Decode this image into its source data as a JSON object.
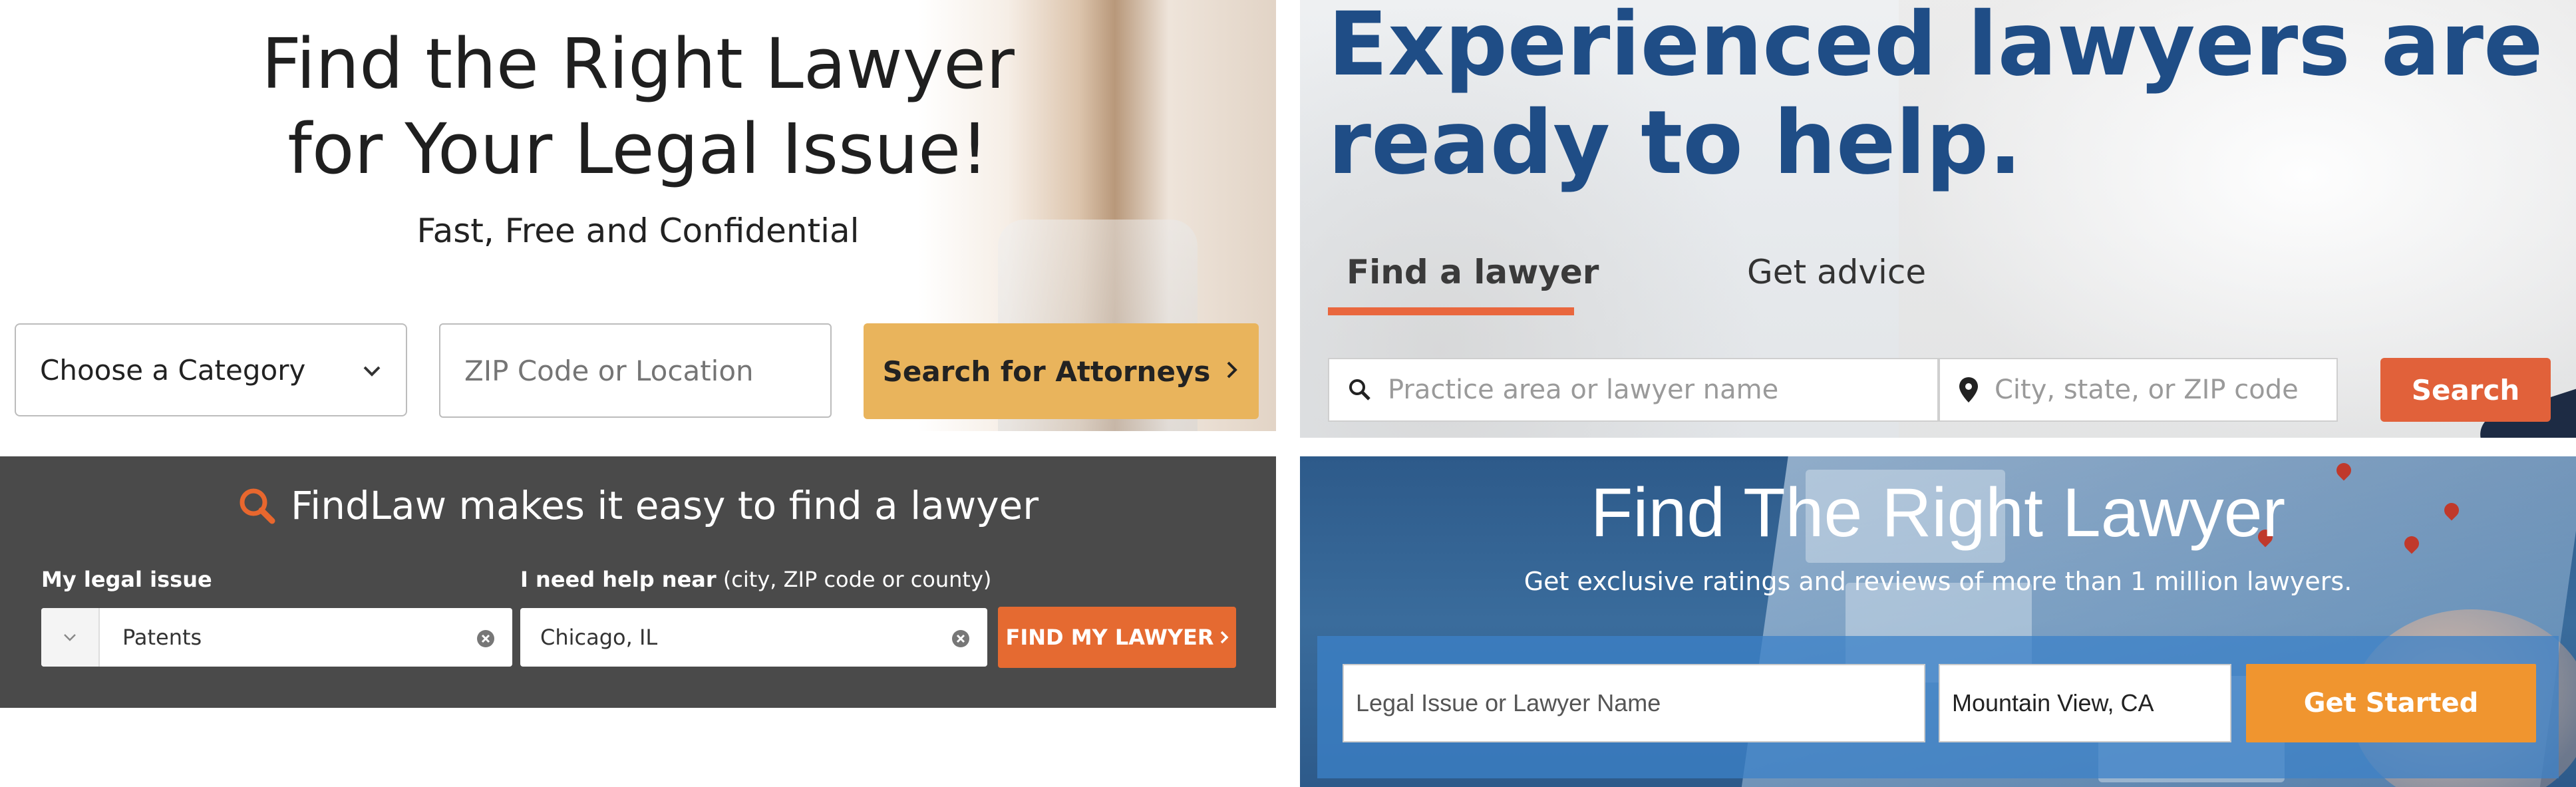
{
  "panel1": {
    "headline_line1": "Find the Right Lawyer",
    "headline_line2": "for Your Legal Issue!",
    "subheadline": "Fast, Free and Confidential",
    "category_select": "Choose a Category",
    "location_placeholder": "ZIP Code or Location",
    "search_button": "Search for Attorneys",
    "colors": {
      "button": "#e9b45c"
    }
  },
  "panel2": {
    "headline_line1": "Experienced lawyers are",
    "headline_line2": "ready to help.",
    "tabs": [
      {
        "label": "Find a lawyer",
        "active": true
      },
      {
        "label": "Get advice",
        "active": false
      }
    ],
    "practice_placeholder": "Practice area or lawyer name",
    "city_placeholder": "City, state, or ZIP code",
    "search_button": "Search",
    "colors": {
      "headline": "#1f4d86",
      "accent": "#e1613a"
    }
  },
  "panel3": {
    "title": "FindLaw makes it easy to find a lawyer",
    "legal_issue_label": "My legal issue",
    "help_near_label": "I need help near",
    "help_near_hint": "(city, ZIP code or county)",
    "legal_issue_value": "Patents",
    "location_value": "Chicago, IL",
    "find_button": "FIND MY LAWYER",
    "colors": {
      "background": "#4a4a4a",
      "button": "#e56a31"
    }
  },
  "panel4": {
    "headline": "Find The Right Lawyer",
    "subheadline": "Get exclusive ratings and reviews of more than 1 million lawyers.",
    "issue_placeholder": "Legal Issue or Lawyer Name",
    "location_value": "Mountain View, CA",
    "start_button": "Get Started",
    "colors": {
      "button": "#f0952f"
    }
  }
}
